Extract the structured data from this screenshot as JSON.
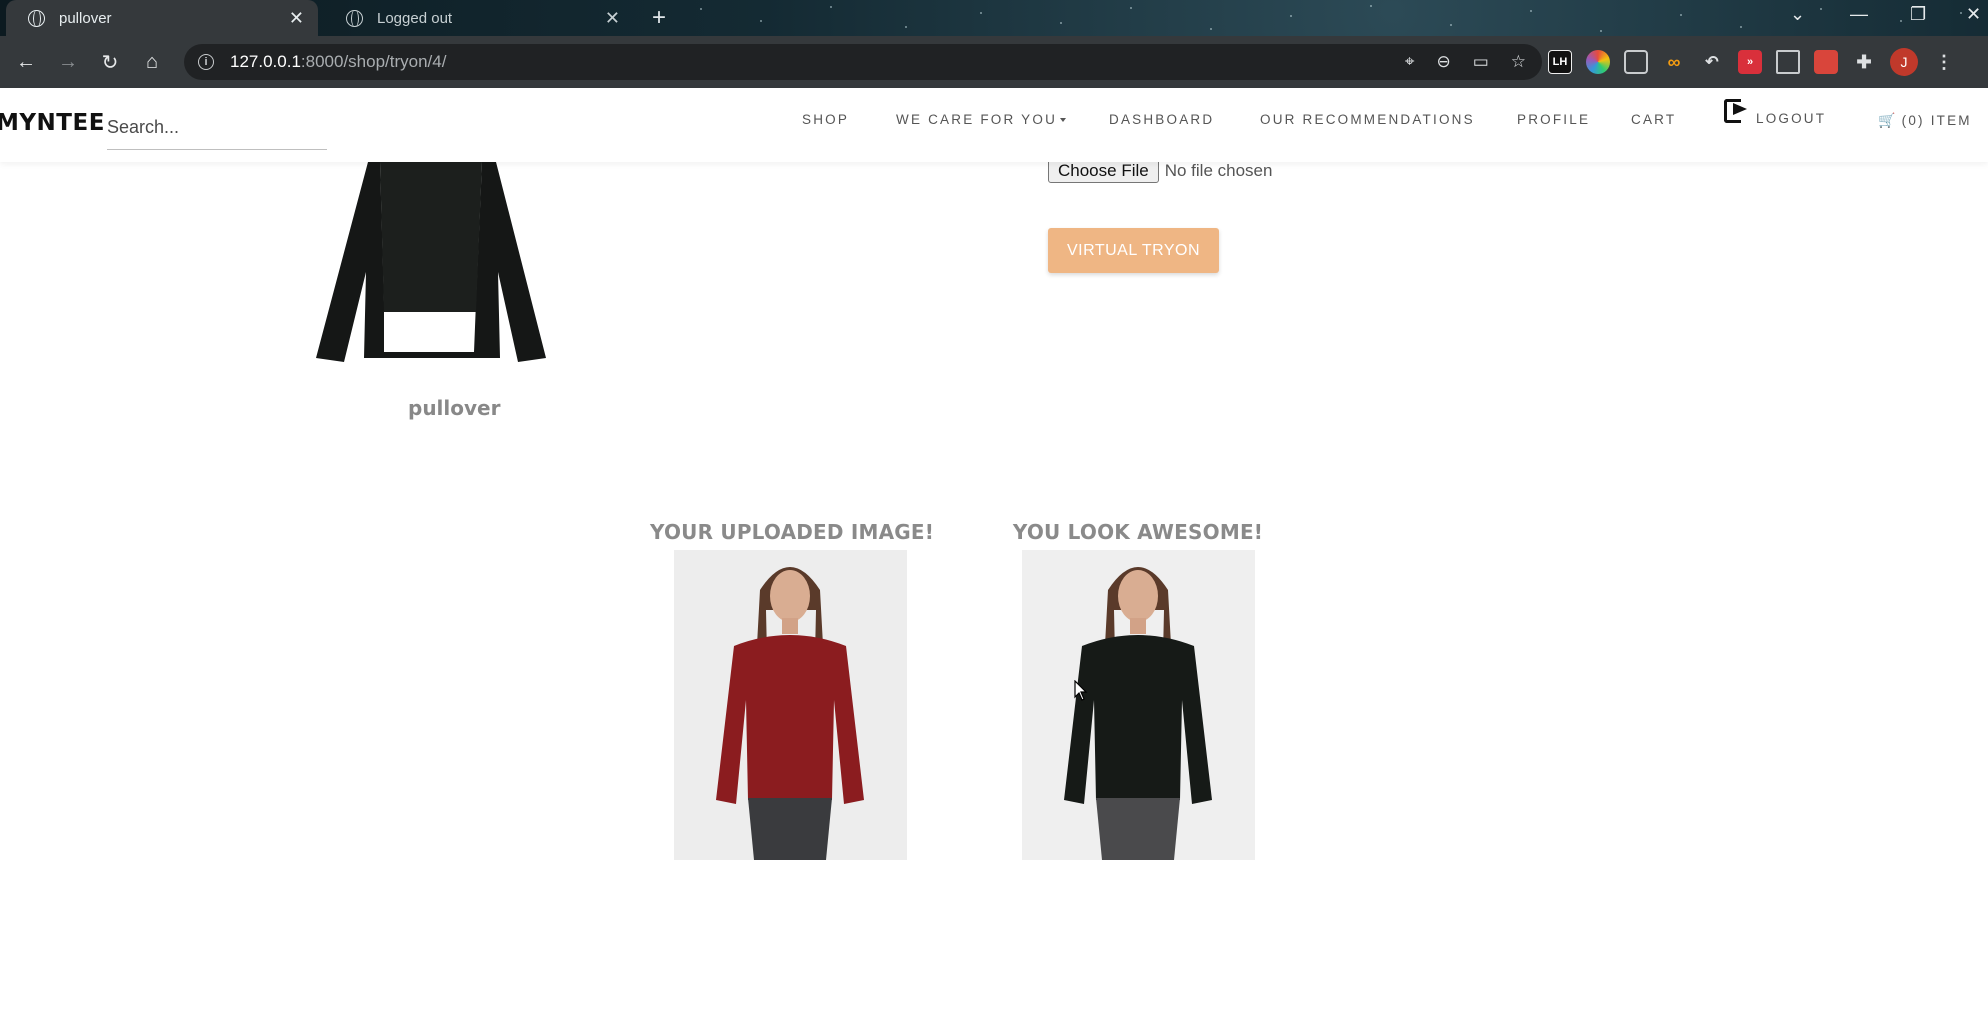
{
  "browser": {
    "tabs": [
      {
        "title": "pullover",
        "active": true
      },
      {
        "title": "Logged out",
        "active": false
      }
    ],
    "url_host": "127.0.0.1",
    "url_path": ":8000/shop/tryon/4/",
    "profile_initial": "J"
  },
  "site": {
    "brand": "MYNTEE",
    "search_placeholder": "Search...",
    "nav": {
      "shop": "SHOP",
      "we_care": "WE CARE FOR YOU",
      "dashboard": "DASHBOARD",
      "recommendations": "OUR RECOMMENDATIONS",
      "profile": "PROFILE",
      "cart": "CART",
      "logout": "LOGOUT",
      "cart_count": "(0) ITEM"
    }
  },
  "product": {
    "name": "pullover"
  },
  "upload": {
    "choose_label": "Choose File",
    "status": "No file chosen",
    "tryon_label": "VIRTUAL TRYON"
  },
  "results": {
    "uploaded_heading": "YOUR UPLOADED IMAGE!",
    "output_heading": "YOU LOOK AWESOME!"
  },
  "colors": {
    "tryon_button": "#efb684",
    "uploaded_shirt": "#8b1c1f",
    "tryon_shirt": "#161a17"
  }
}
